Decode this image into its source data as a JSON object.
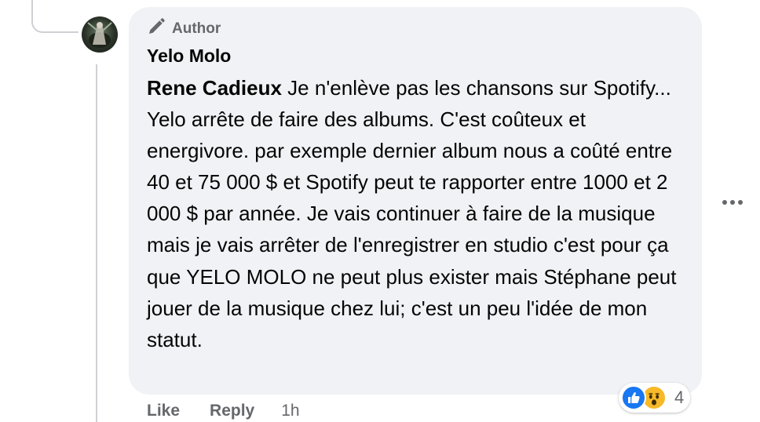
{
  "comment": {
    "badge_label": "Author",
    "author_name": "Yelo Molo",
    "mention": "Rene Cadieux",
    "body": " Je n'enlève pas les chansons sur Spotify... Yelo arrête de faire des albums. C'est coûteux et energivore. par exemple dernier album nous a coûté entre 40 et 75 000 $ et Spotify peut te rapporter entre 1000 et 2 000 $ par année. Je vais continuer à faire de la musique mais je vais arrêter de l'enregistrer en studio c'est pour ça que YELO MOLO ne peut plus exister mais Stéphane peut jouer de la musique chez lui; c'est un peu l'idée de mon statut."
  },
  "reactions": {
    "icons": [
      "like-icon",
      "wow-icon"
    ],
    "count": "4"
  },
  "actions": {
    "like_label": "Like",
    "reply_label": "Reply",
    "timestamp": "1h"
  },
  "colors": {
    "bubble_bg": "#f0f2f5",
    "secondary_text": "#65676b",
    "like_blue": "#1877f2",
    "wow_yellow": "#f7b928"
  }
}
